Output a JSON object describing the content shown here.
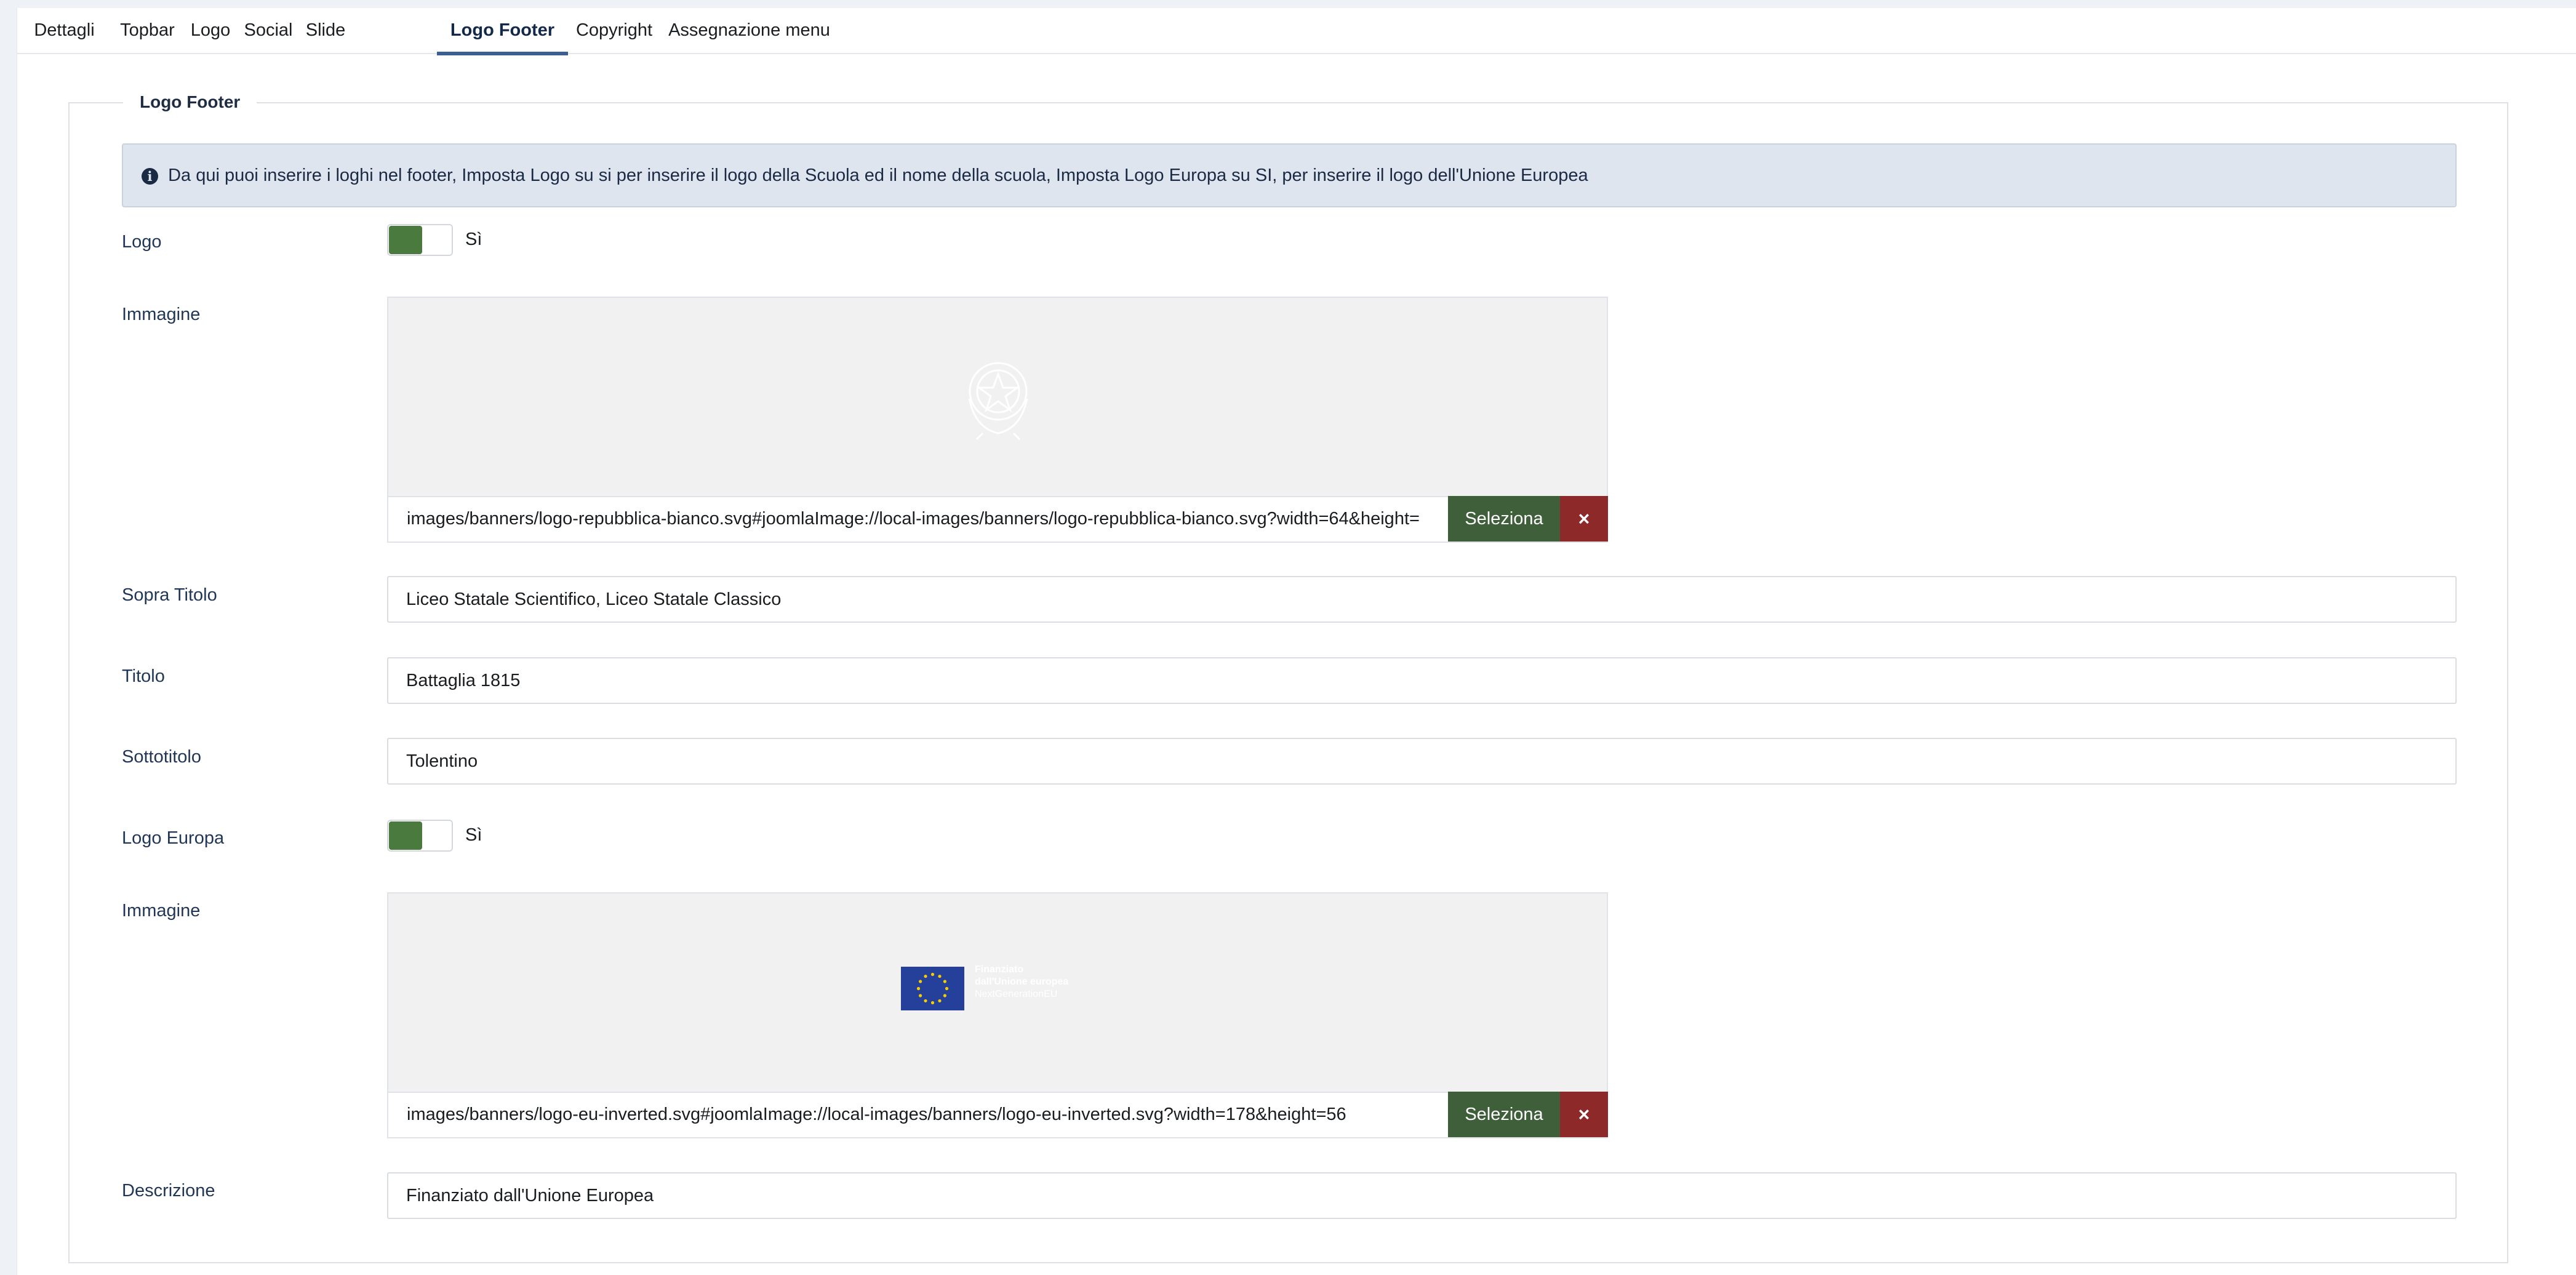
{
  "tabs": [
    {
      "label": "Dettagli"
    },
    {
      "label": "Topbar"
    },
    {
      "label": "Logo"
    },
    {
      "label": "Social"
    },
    {
      "label": "Slide"
    },
    {
      "label": "Logo Footer",
      "active": true
    },
    {
      "label": "Copyright"
    },
    {
      "label": "Assegnazione menu"
    }
  ],
  "section": {
    "legend": "Logo Footer",
    "info": "Da qui puoi inserire i loghi nel footer, Imposta Logo su si per inserire il logo della Scuola ed il nome della scuola, Imposta Logo Europa su SI, per inserire il logo dell'Unione Europea"
  },
  "fields": {
    "logo": {
      "label": "Logo",
      "state": "Sì"
    },
    "image1": {
      "label": "Immagine",
      "path": "images/banners/logo-repubblica-bianco.svg#joomlaImage://local-images/banners/logo-repubblica-bianco.svg?width=64&height=",
      "select_label": "Seleziona",
      "clear_label": "×"
    },
    "sopra_titolo": {
      "label": "Sopra Titolo",
      "value": "Liceo Statale Scientifico, Liceo Statale Classico"
    },
    "titolo": {
      "label": "Titolo",
      "value": "Battaglia 1815"
    },
    "sottotitolo": {
      "label": "Sottotitolo",
      "value": "Tolentino"
    },
    "logo_europa": {
      "label": "Logo Europa",
      "state": "Sì"
    },
    "image2": {
      "label": "Immagine",
      "path": "images/banners/logo-eu-inverted.svg#joomlaImage://local-images/banners/logo-eu-inverted.svg?width=178&height=56",
      "select_label": "Seleziona",
      "clear_label": "×",
      "preview_text": [
        "Finanziato",
        "dall'Unione europea",
        "NextGenerationEU"
      ]
    },
    "descrizione": {
      "label": "Descrizione",
      "value": "Finanziato dall'Unione Europea"
    }
  },
  "colors": {
    "toggle_on": "#4a7a3d",
    "select_button": "#3f5f3a",
    "clear_button": "#8e2929",
    "info_bg": "#dfe5ee",
    "active_tab_indicator": "#3c5f8f"
  }
}
